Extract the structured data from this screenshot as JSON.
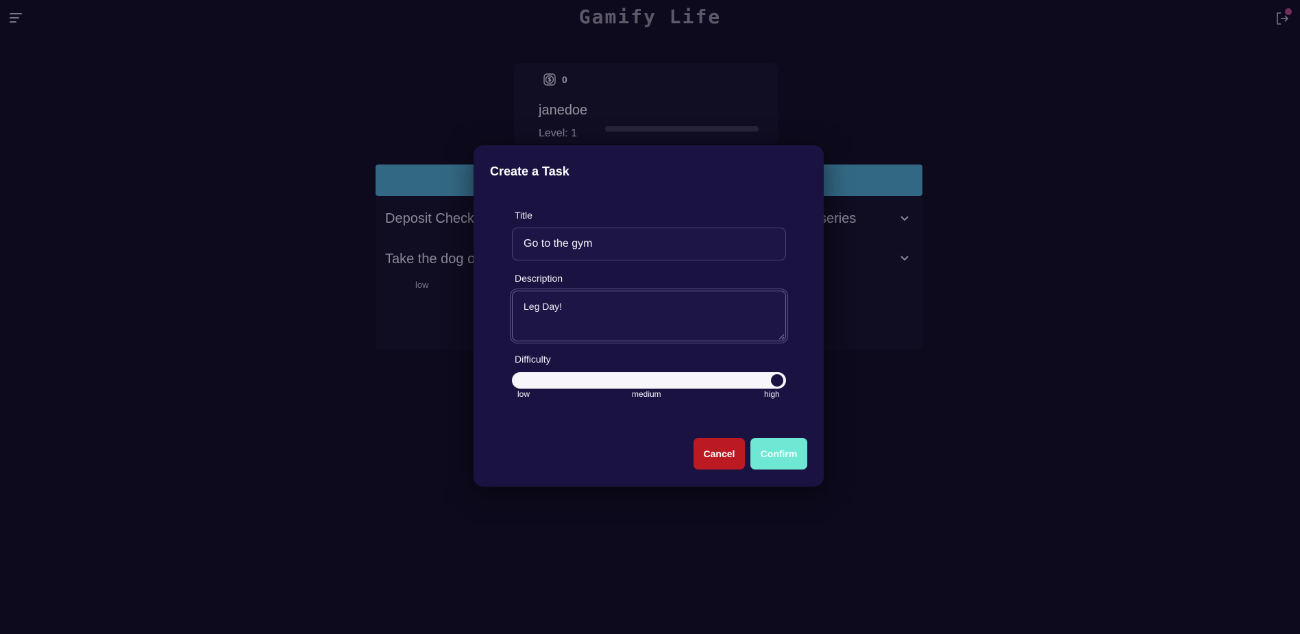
{
  "header": {
    "app_title": "Gamify Life"
  },
  "profile": {
    "coins": "0",
    "username": "janedoe",
    "level_label": "Level: 1",
    "xp_progress": 0
  },
  "tasks": {
    "items": [
      {
        "title": "Deposit Check",
        "trailing_text": "series"
      },
      {
        "title": "Take the dog o",
        "difficulty": "low"
      }
    ]
  },
  "modal": {
    "title": "Create a Task",
    "title_label": "Title",
    "title_value": "Go to the gym",
    "description_label": "Description",
    "description_value": "Leg Day!",
    "difficulty_label": "Difficulty",
    "difficulty_value": "high",
    "difficulty_options": [
      "low",
      "medium",
      "high"
    ],
    "cancel_label": "Cancel",
    "confirm_label": "Confirm"
  },
  "colors": {
    "background": "#100c23",
    "modal_bg": "#1a1240",
    "cancel": "#bb1a22",
    "confirm": "#6ee8d4",
    "accent_bar": "#4da4c9",
    "notification": "#b04a84"
  }
}
